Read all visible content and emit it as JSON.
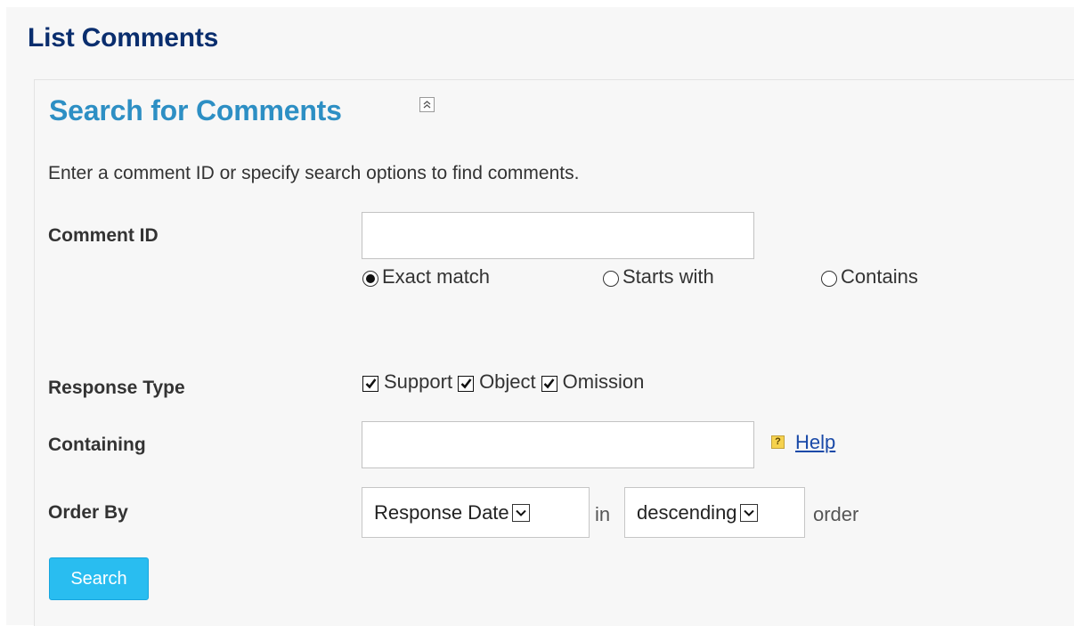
{
  "page": {
    "title": "List Comments"
  },
  "search": {
    "title": "Search for Comments",
    "collapse_icon": "double-chevron-up-icon",
    "intro": "Enter a comment ID or specify search options to find comments.",
    "comment_id": {
      "label": "Comment ID",
      "value": "",
      "match_options": [
        {
          "label": "Exact match",
          "checked": true
        },
        {
          "label": "Starts with",
          "checked": false
        },
        {
          "label": "Contains",
          "checked": false
        }
      ]
    },
    "response_type": {
      "label": "Response Type",
      "options": [
        {
          "label": "Support",
          "checked": true
        },
        {
          "label": "Object",
          "checked": true
        },
        {
          "label": "Omission",
          "checked": true
        }
      ]
    },
    "containing": {
      "label": "Containing",
      "value": "",
      "help_icon": "question-mark-icon",
      "help_label": "Help"
    },
    "order_by": {
      "label": "Order By",
      "field": "Response Date",
      "in_text": "in",
      "direction": "descending",
      "suffix": "order"
    },
    "button_label": "Search"
  },
  "colors": {
    "page_title": "#0a2e6e",
    "section_title": "#2d8fc4",
    "button_bg": "#29bdf0",
    "link": "#1a4aa8",
    "background": "#f7f7f7"
  }
}
